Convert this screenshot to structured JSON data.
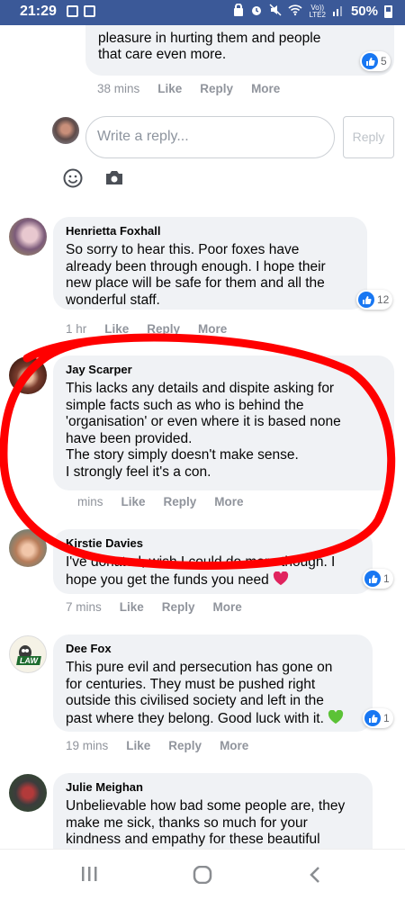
{
  "status_bar": {
    "time": "21:29",
    "network_label": "Vo))\nLTE2",
    "battery": "50%"
  },
  "prev_comment": {
    "text_lines": "saved from their hunts and take\npleasure in hurting them and people\nthat care even more.",
    "reaction_count": "5",
    "time": "38 mins",
    "like": "Like",
    "reply": "Reply",
    "more": "More"
  },
  "reply_box": {
    "placeholder": "Write a reply...",
    "button": "Reply"
  },
  "comments": [
    {
      "name": "Henrietta Foxhall",
      "text": "So sorry to hear this. Poor foxes have\nalready been through enough. I hope their\nnew place will be safe for them and all the\nwonderful staff.",
      "reaction_count": "12",
      "time": "1 hr",
      "like": "Like",
      "reply": "Reply",
      "more": "More"
    },
    {
      "name": "Jay Scarper",
      "text": "This lacks any details and dispite asking for\nsimple facts such as who is behind the\n'organisation' or even where it is based none\nhave been provided.\nThe story simply doesn't make sense.\nI strongly feel it's a con.",
      "time": "mins",
      "like": "Like",
      "reply": "Reply",
      "more": "More"
    },
    {
      "name": "Kirstie Davies",
      "text": "I've donated, wish I could do more though. I\nhope you get the funds you need",
      "reaction_count": "1",
      "time": "7 mins",
      "like": "Like",
      "reply": "Reply",
      "more": "More"
    },
    {
      "name": "Dee Fox",
      "avatar_text": "LAW",
      "text": "This pure evil and persecution has gone on\nfor centuries. They must be pushed right\noutside this civilised society and left in the\npast where they belong. Good luck with it.",
      "reaction_count": "1",
      "time": "19 mins",
      "like": "Like",
      "reply": "Reply",
      "more": "More"
    },
    {
      "name": "Julie Meighan",
      "text": "Unbelievable how bad some people are, they\nmake me sick, thanks so much for your\nkindness and empathy for these beautiful"
    }
  ],
  "colors": {
    "status_bar": "#3b5998",
    "like_blue": "#1877f2",
    "bubble": "#f0f2f5",
    "annotation_red": "#ff0000"
  },
  "icons": [
    "smiley-icon",
    "camera-icon",
    "like-reaction-icon",
    "heart-emoji-icon",
    "green-heart-emoji-icon",
    "recents-icon",
    "home-icon",
    "back-icon"
  ]
}
